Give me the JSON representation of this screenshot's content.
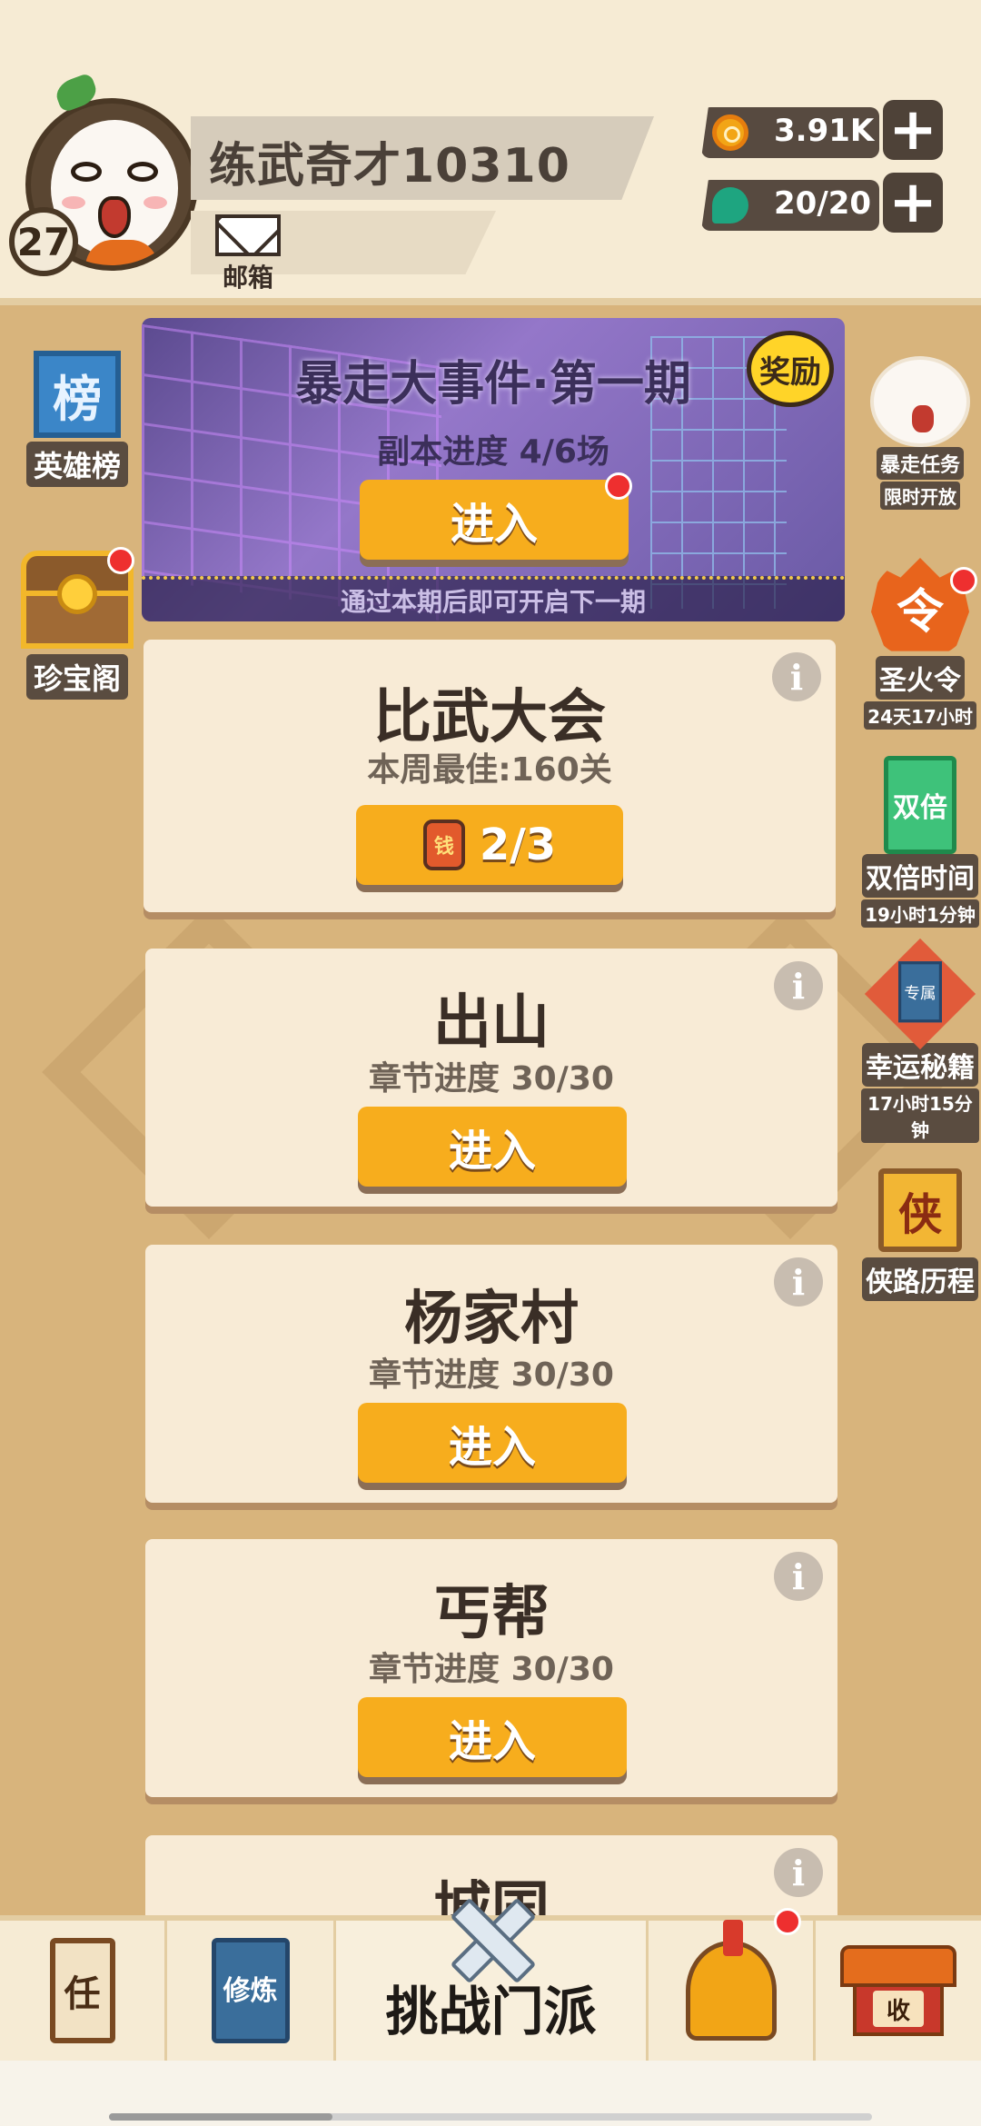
{
  "player": {
    "name": "练武奇才10310",
    "level": "27"
  },
  "mailbox": {
    "label": "邮箱"
  },
  "resources": {
    "coins": "3.91K",
    "gems": "20/20",
    "plus": "+"
  },
  "left_icons": [
    {
      "label": "英雄榜",
      "glyph": "榜"
    },
    {
      "label": "珍宝阁"
    }
  ],
  "right_icons": [
    {
      "label": "暴走任务",
      "sub": "限时开放"
    },
    {
      "label": "圣火令",
      "glyph": "令",
      "sub": "24天17小时"
    },
    {
      "label": "双倍时间",
      "glyph": "双倍",
      "sub": "19小时1分钟"
    },
    {
      "label": "幸运秘籍",
      "glyph": "专属",
      "sub": "17小时15分钟"
    },
    {
      "label": "侠路历程",
      "glyph": "侠"
    }
  ],
  "event": {
    "title": "暴走大事件·第一期",
    "progress": "副本进度 4/6场",
    "button": "进入",
    "footer": "通过本期后即可开启下一期",
    "badge": "奖励"
  },
  "cards": [
    {
      "title": "比武大会",
      "subtitle": "本周最佳:160关",
      "button": "2/3",
      "token": "钱"
    },
    {
      "title": "出山",
      "subtitle": "章节进度 30/30",
      "button": "进入"
    },
    {
      "title": "杨家村",
      "subtitle": "章节进度 30/30",
      "button": "进入"
    },
    {
      "title": "丐帮",
      "subtitle": "章节进度 30/30",
      "button": "进入"
    },
    {
      "title": "城国"
    }
  ],
  "info_glyph": "i",
  "bottom_nav": {
    "task_glyph": "任",
    "train_glyph": "修炼",
    "challenge_label": "挑战门派",
    "collect_glyph": "收"
  }
}
